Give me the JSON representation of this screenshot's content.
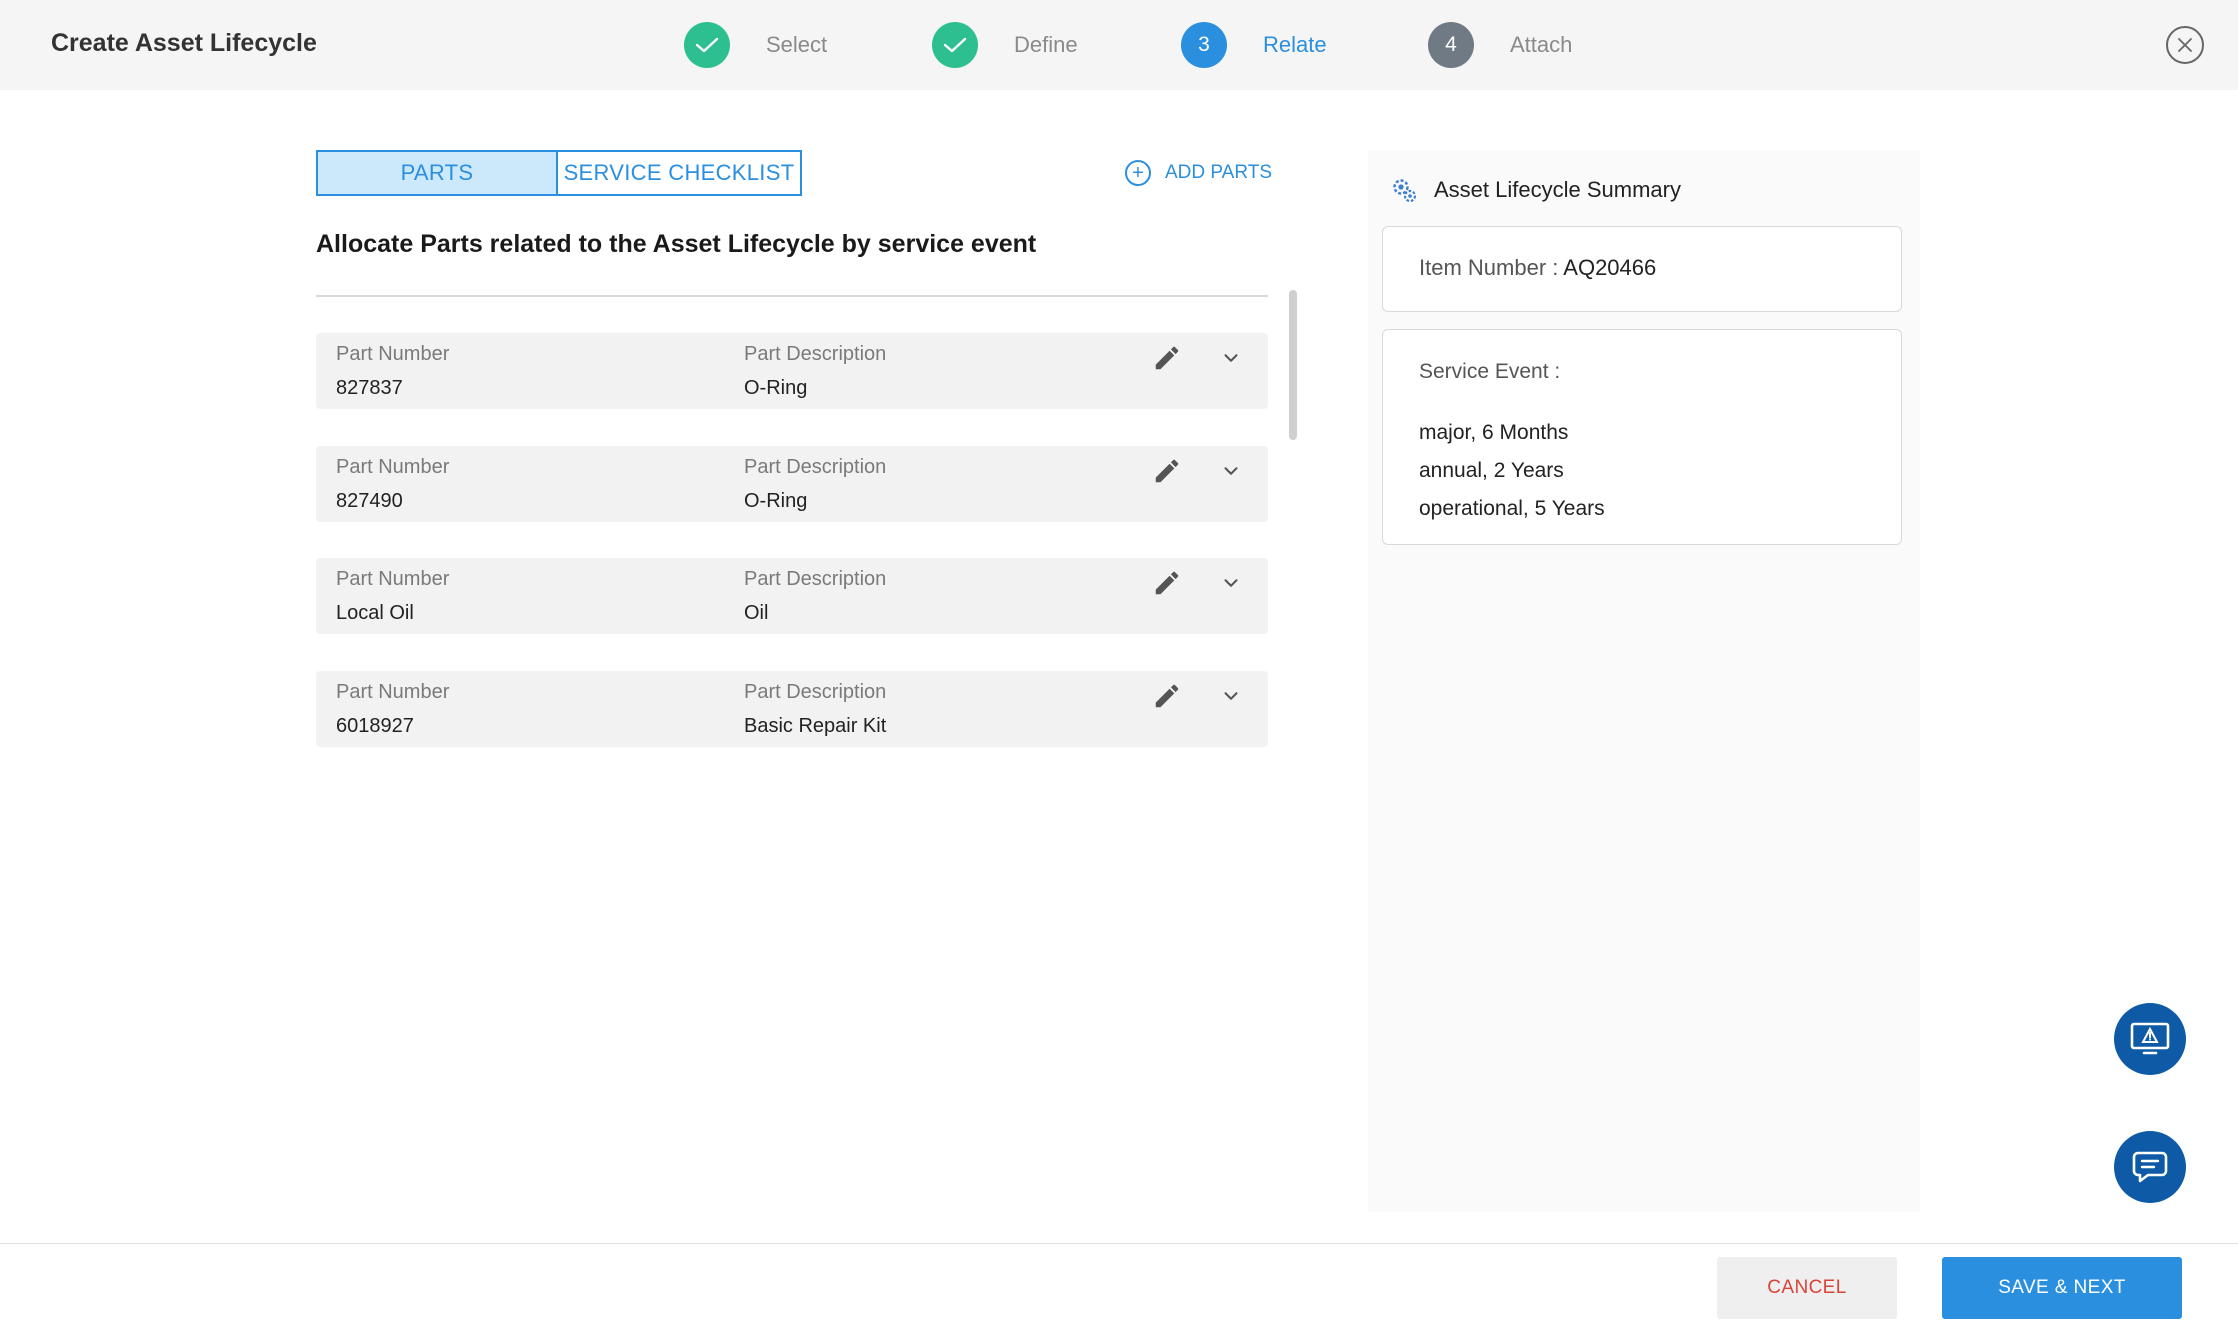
{
  "header": {
    "title": "Create Asset Lifecycle",
    "steps": [
      {
        "label": "Select",
        "state": "done",
        "number": ""
      },
      {
        "label": "Define",
        "state": "done",
        "number": ""
      },
      {
        "label": "Relate",
        "state": "active",
        "number": "3"
      },
      {
        "label": "Attach",
        "state": "pending",
        "number": "4"
      }
    ],
    "close_icon": "close-icon"
  },
  "tabs": [
    {
      "label": "PARTS",
      "active": true
    },
    {
      "label": "SERVICE CHECKLIST",
      "active": false
    }
  ],
  "add_parts_label": "ADD PARTS",
  "heading": "Allocate Parts related to the Asset Lifecycle by service event",
  "parts": [
    {
      "number_label": "Part Number",
      "number": "827837",
      "description_label": "Part Description",
      "description": "O-Ring"
    },
    {
      "number_label": "Part Number",
      "number": "827490",
      "description_label": "Part Description",
      "description": "O-Ring"
    },
    {
      "number_label": "Part Number",
      "number": "Local Oil",
      "description_label": "Part Description",
      "description": "Oil"
    },
    {
      "number_label": "Part Number",
      "number": "6018927",
      "description_label": "Part Description",
      "description": "Basic Repair Kit"
    }
  ],
  "summary": {
    "title": "Asset Lifecycle Summary",
    "item_number_label": "Item Number : ",
    "item_number": "AQ20466",
    "service_event_label": "Service Event :",
    "service_events": [
      "major, 6 Months",
      "annual, 2 Years",
      "operational, 5 Years"
    ]
  },
  "footer": {
    "cancel_label": "CANCEL",
    "save_label": "SAVE & NEXT"
  },
  "colors": {
    "accent": "#2b8fe0",
    "done": "#2ebf91",
    "pending": "#707a84",
    "cancel_text": "#d9443a",
    "fab": "#0e5aa7"
  }
}
